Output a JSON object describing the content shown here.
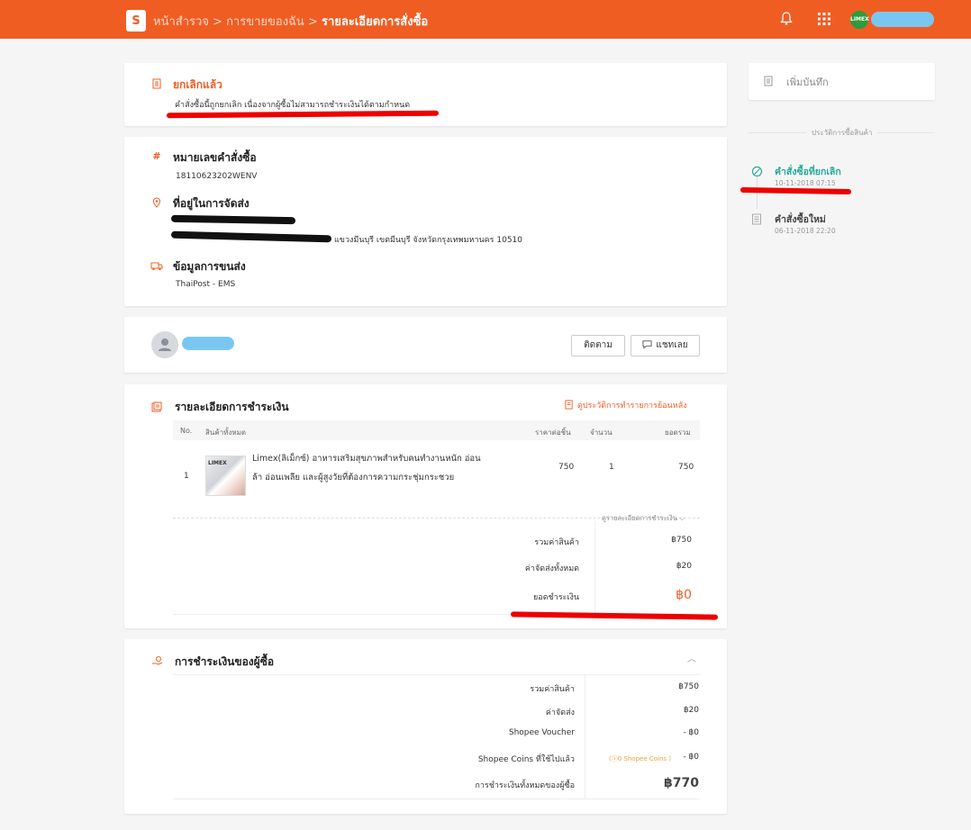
{
  "header": {
    "logo_letter": "S",
    "crumb1": "หน้าสำรวจ",
    "sep1": " > ",
    "crumb2": "การขายของฉัน",
    "sep2": " > ",
    "crumb3": "รายละเอียดการสั่งซื้อ",
    "avatar_text": "LIMEX"
  },
  "status": {
    "title": "ยกเลิกแล้ว",
    "message": "คำสั่งซื้อนี้ถูกยกเลิก เนื่องจากผู้ซื้อไม่สามารถชำระเงินได้ตามกำหนด"
  },
  "order_info": {
    "order_no_label": "หมายเลขคำสั่งซื้อ",
    "order_no": "18110623202WENV",
    "address_label": "ที่อยู่ในการจัดส่ง",
    "address_tail": "แขวงมีนบุรี เขตมีนบุรี จังหวัดกรุงเทพมหานคร 10510",
    "shipping_label": "ข้อมูลการขนส่ง",
    "shipping_value": "ThaiPost - EMS"
  },
  "buyer": {
    "follow_label": "ติดตาม",
    "chat_label": "แชทเลย"
  },
  "payment": {
    "title": "รายละเอียดการชำระเงิน",
    "history_link": "ดูประวัติการทำรายการย้อนหลัง",
    "columns": [
      "No.",
      "สินค้าทั้งหมด",
      "ราคาต่อชิ้น",
      "จำนวน",
      "ยอดรวม"
    ],
    "item": {
      "no": "1",
      "name_line1": "Limex(ลิเม็กซ์) อาหารเสริมสุขภาพสำหรับคนทำงานหนัก อ่อน",
      "name_line2": "ล้า อ่อนเพลีย และผู้สูงวัยที่ต้องการความกระชุ่มกระชวย",
      "price": "750",
      "qty": "1",
      "total": "750",
      "thumb_text": "LIMEX"
    },
    "detail_link": "ดูรายละเอียดการชำระเงิน",
    "subtotal_label": "รวมค่าสินค้า",
    "subtotal": "฿750",
    "shipping_label": "ค่าจัดส่งทั้งหมด",
    "shipping": "฿20",
    "grand_label": "ยอดชำระเงิน",
    "grand": "฿0"
  },
  "buyer_payment": {
    "title": "การชำระเงินของผู้ซื้อ",
    "rows": [
      {
        "label": "รวมค่าสินค้า",
        "value": "฿750"
      },
      {
        "label": "ค่าจัดส่ง",
        "value": "฿20"
      },
      {
        "label": "Shopee Voucher",
        "value": "- ฿0"
      },
      {
        "label": "Shopee Coins ที่ใช้ไปแล้ว",
        "value": "- ฿0"
      }
    ],
    "coins_note": "(ⓢ0 Shopee Coins )",
    "total_label": "การชำระเงินทั้งหมดของผู้ซื้อ",
    "total": "฿770"
  },
  "sidebar": {
    "note_label": "เพิ่มบันทึก",
    "history_title": "ประวัติการซื้อสินค้า",
    "events": [
      {
        "title": "คำสั่งซื้อที่ยกเลิก",
        "time": "10-11-2018 07:15"
      },
      {
        "title": "คำสั่งซื้อใหม่",
        "time": "06-11-2018 22:20"
      }
    ]
  },
  "colors": {
    "brand": "#f05d23",
    "cancel_green": "#26aa99",
    "annotation_red": "#e00000"
  }
}
